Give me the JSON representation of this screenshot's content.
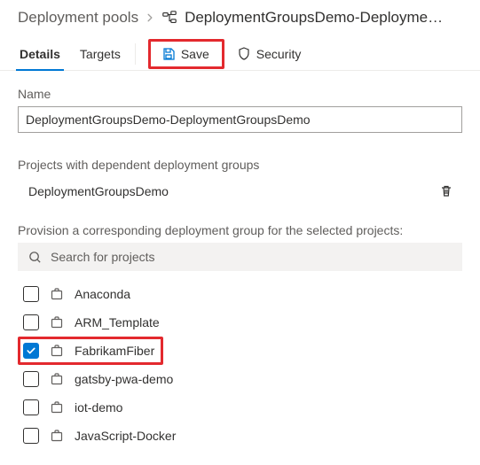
{
  "breadcrumb": {
    "root": "Deployment pools",
    "current": "DeploymentGroupsDemo-Deployment..."
  },
  "tabs": {
    "details": "Details",
    "targets": "Targets"
  },
  "toolbar": {
    "save": "Save",
    "security": "Security"
  },
  "nameField": {
    "label": "Name",
    "value": "DeploymentGroupsDemo-DeploymentGroupsDemo"
  },
  "dependent": {
    "label": "Projects with dependent deployment groups",
    "items": [
      "DeploymentGroupsDemo"
    ]
  },
  "provision": {
    "label": "Provision a corresponding deployment group for the selected projects:",
    "searchPlaceholder": "Search for projects",
    "projects": [
      {
        "name": "Anaconda",
        "checked": false
      },
      {
        "name": "ARM_Template",
        "checked": false
      },
      {
        "name": "FabrikamFiber",
        "checked": true
      },
      {
        "name": "gatsby-pwa-demo",
        "checked": false
      },
      {
        "name": "iot-demo",
        "checked": false
      },
      {
        "name": "JavaScript-Docker",
        "checked": false
      }
    ]
  }
}
